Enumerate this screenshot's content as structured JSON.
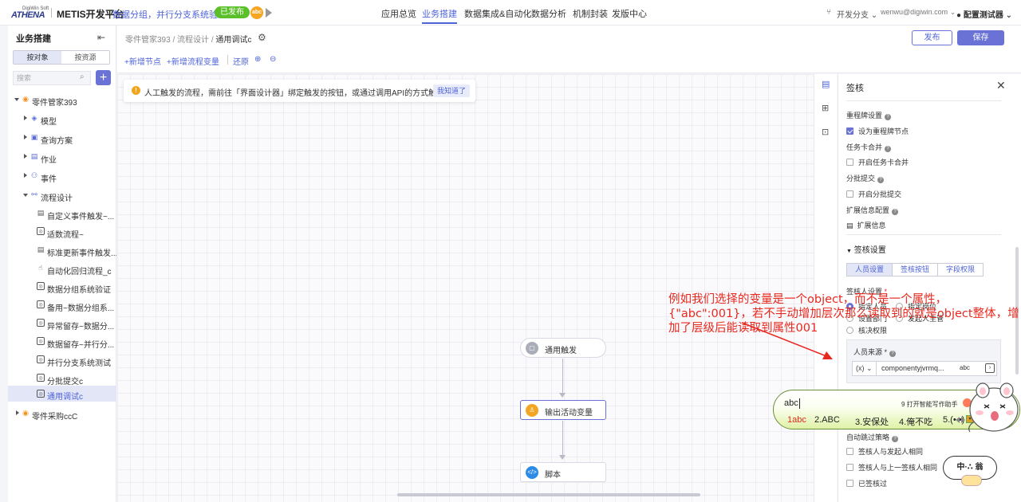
{
  "topnav": {
    "logo_top": "DigiWin Soft",
    "logo_main": "ATHENA",
    "platform": "METIS开发平台",
    "app_name": "数据分组，并行分支系统验证",
    "status_badge": "已发布",
    "icon_badge": "abc",
    "tabs": [
      {
        "label": "应用总览",
        "active": false
      },
      {
        "label": "业务搭建",
        "active": true
      },
      {
        "label": "数据集成&自动化",
        "active": false
      },
      {
        "label": "数据分析",
        "active": false
      },
      {
        "label": "机制封装",
        "active": false
      },
      {
        "label": "发版中心",
        "active": false
      }
    ],
    "branch": "开发分支",
    "email": "wenwu@digiwin.com",
    "user": "配置测试器"
  },
  "sidebar": {
    "title": "业务搭建",
    "seg": [
      "按对象",
      "按资源"
    ],
    "search_placeholder": "搜索",
    "tree": [
      {
        "label": "零件管家393",
        "level": 0,
        "expanded": true,
        "icon": "orange-circle-icon"
      },
      {
        "label": "模型",
        "level": 1,
        "icon": "cube-icon"
      },
      {
        "label": "查询方案",
        "level": 1,
        "icon": "query-icon"
      },
      {
        "label": "作业",
        "level": 1,
        "icon": "job-icon"
      },
      {
        "label": "事件",
        "level": 1,
        "icon": "event-icon"
      },
      {
        "label": "流程设计",
        "level": 1,
        "expanded": true,
        "icon": "flow-icon"
      },
      {
        "label": "自定义事件触发~...",
        "level": 2,
        "icon": "doc-icon"
      },
      {
        "label": "适数流程~",
        "level": 2,
        "icon": "flow-box-icon"
      },
      {
        "label": "标准更新事件触发...",
        "level": 2,
        "icon": "doc-icon"
      },
      {
        "label": "自动化回归流程_c",
        "level": 2,
        "icon": "hand-icon"
      },
      {
        "label": "数据分组系统验证",
        "level": 2,
        "icon": "flow-box-icon"
      },
      {
        "label": "备用~数据分组系...",
        "level": 2,
        "icon": "flow-box-icon"
      },
      {
        "label": "异常留存~数据分...",
        "level": 2,
        "icon": "flow-box-icon"
      },
      {
        "label": "数据留存~并行分...",
        "level": 2,
        "icon": "flow-box-icon"
      },
      {
        "label": "并行分支系统测试",
        "level": 2,
        "icon": "flow-box-icon"
      },
      {
        "label": "分批提交c",
        "level": 2,
        "icon": "flow-box-icon"
      },
      {
        "label": "通用调试c",
        "level": 2,
        "icon": "flow-box-icon",
        "selected": true
      },
      {
        "label": "零件采购ccC",
        "level": 0,
        "expanded": false,
        "icon": "orange-circle-icon"
      }
    ]
  },
  "canvas": {
    "breadcrumb": [
      "零件管家393",
      "流程设计",
      "通用调试c"
    ],
    "toolbar": {
      "add_node": "+新增节点",
      "add_var": "+新增流程变量",
      "restore": "还原"
    },
    "publish": "发布",
    "save": "保存",
    "banner": "人工触发的流程，需前往「界面设计器」绑定触发的按钮，或通过调用API的方式触发。",
    "banner_ok": "我知道了",
    "nodes": [
      {
        "label": "通用触发",
        "color": "#a9adb8"
      },
      {
        "label": "输出活动变量",
        "color": "#f2a623"
      },
      {
        "label": "脚本",
        "color": "#2b8be6"
      }
    ]
  },
  "panel": {
    "title": "签核",
    "collapse_label": "重程牌设置",
    "collapse_check": "设为重程牌节点",
    "merge_label": "任务卡合并",
    "merge_check": "开启任务卡合并",
    "batch_label": "分批提交",
    "batch_check": "开启分批提交",
    "ext_label": "扩展信息配置",
    "ext_link": "扩展信息",
    "section": "签核设置",
    "tabs": [
      "人员设置",
      "签核按钮",
      "字段权限"
    ],
    "approver_label": "签核人设置",
    "radios": [
      "指定人员",
      "指定岗位",
      "设置部门",
      "发起人主管",
      "核决权限"
    ],
    "source_label": "人员来源",
    "source_fx": "(x)",
    "source_value": "componentyjvrmq...",
    "source_tag": "abc",
    "skip_label": "自动跳过策略",
    "skip_opts": [
      "签核人与发起人相同",
      "签核人与上一签核人相同",
      "已签核过"
    ]
  },
  "annotation": "例如我们选择的变量是一个object，而不是一个属性，{\"abc\":001}，若不手动增加层次那么读取到的就是object整体，增加了层级后能读取到属性001",
  "ime": {
    "typed": "abc",
    "assistant": "9 打开智能写作助手",
    "candidates": [
      "1abc",
      "2.ABC",
      "3.安保处",
      "4.俺不吃",
      "5.(• •)"
    ],
    "sticker": "中·∴ 翁"
  }
}
